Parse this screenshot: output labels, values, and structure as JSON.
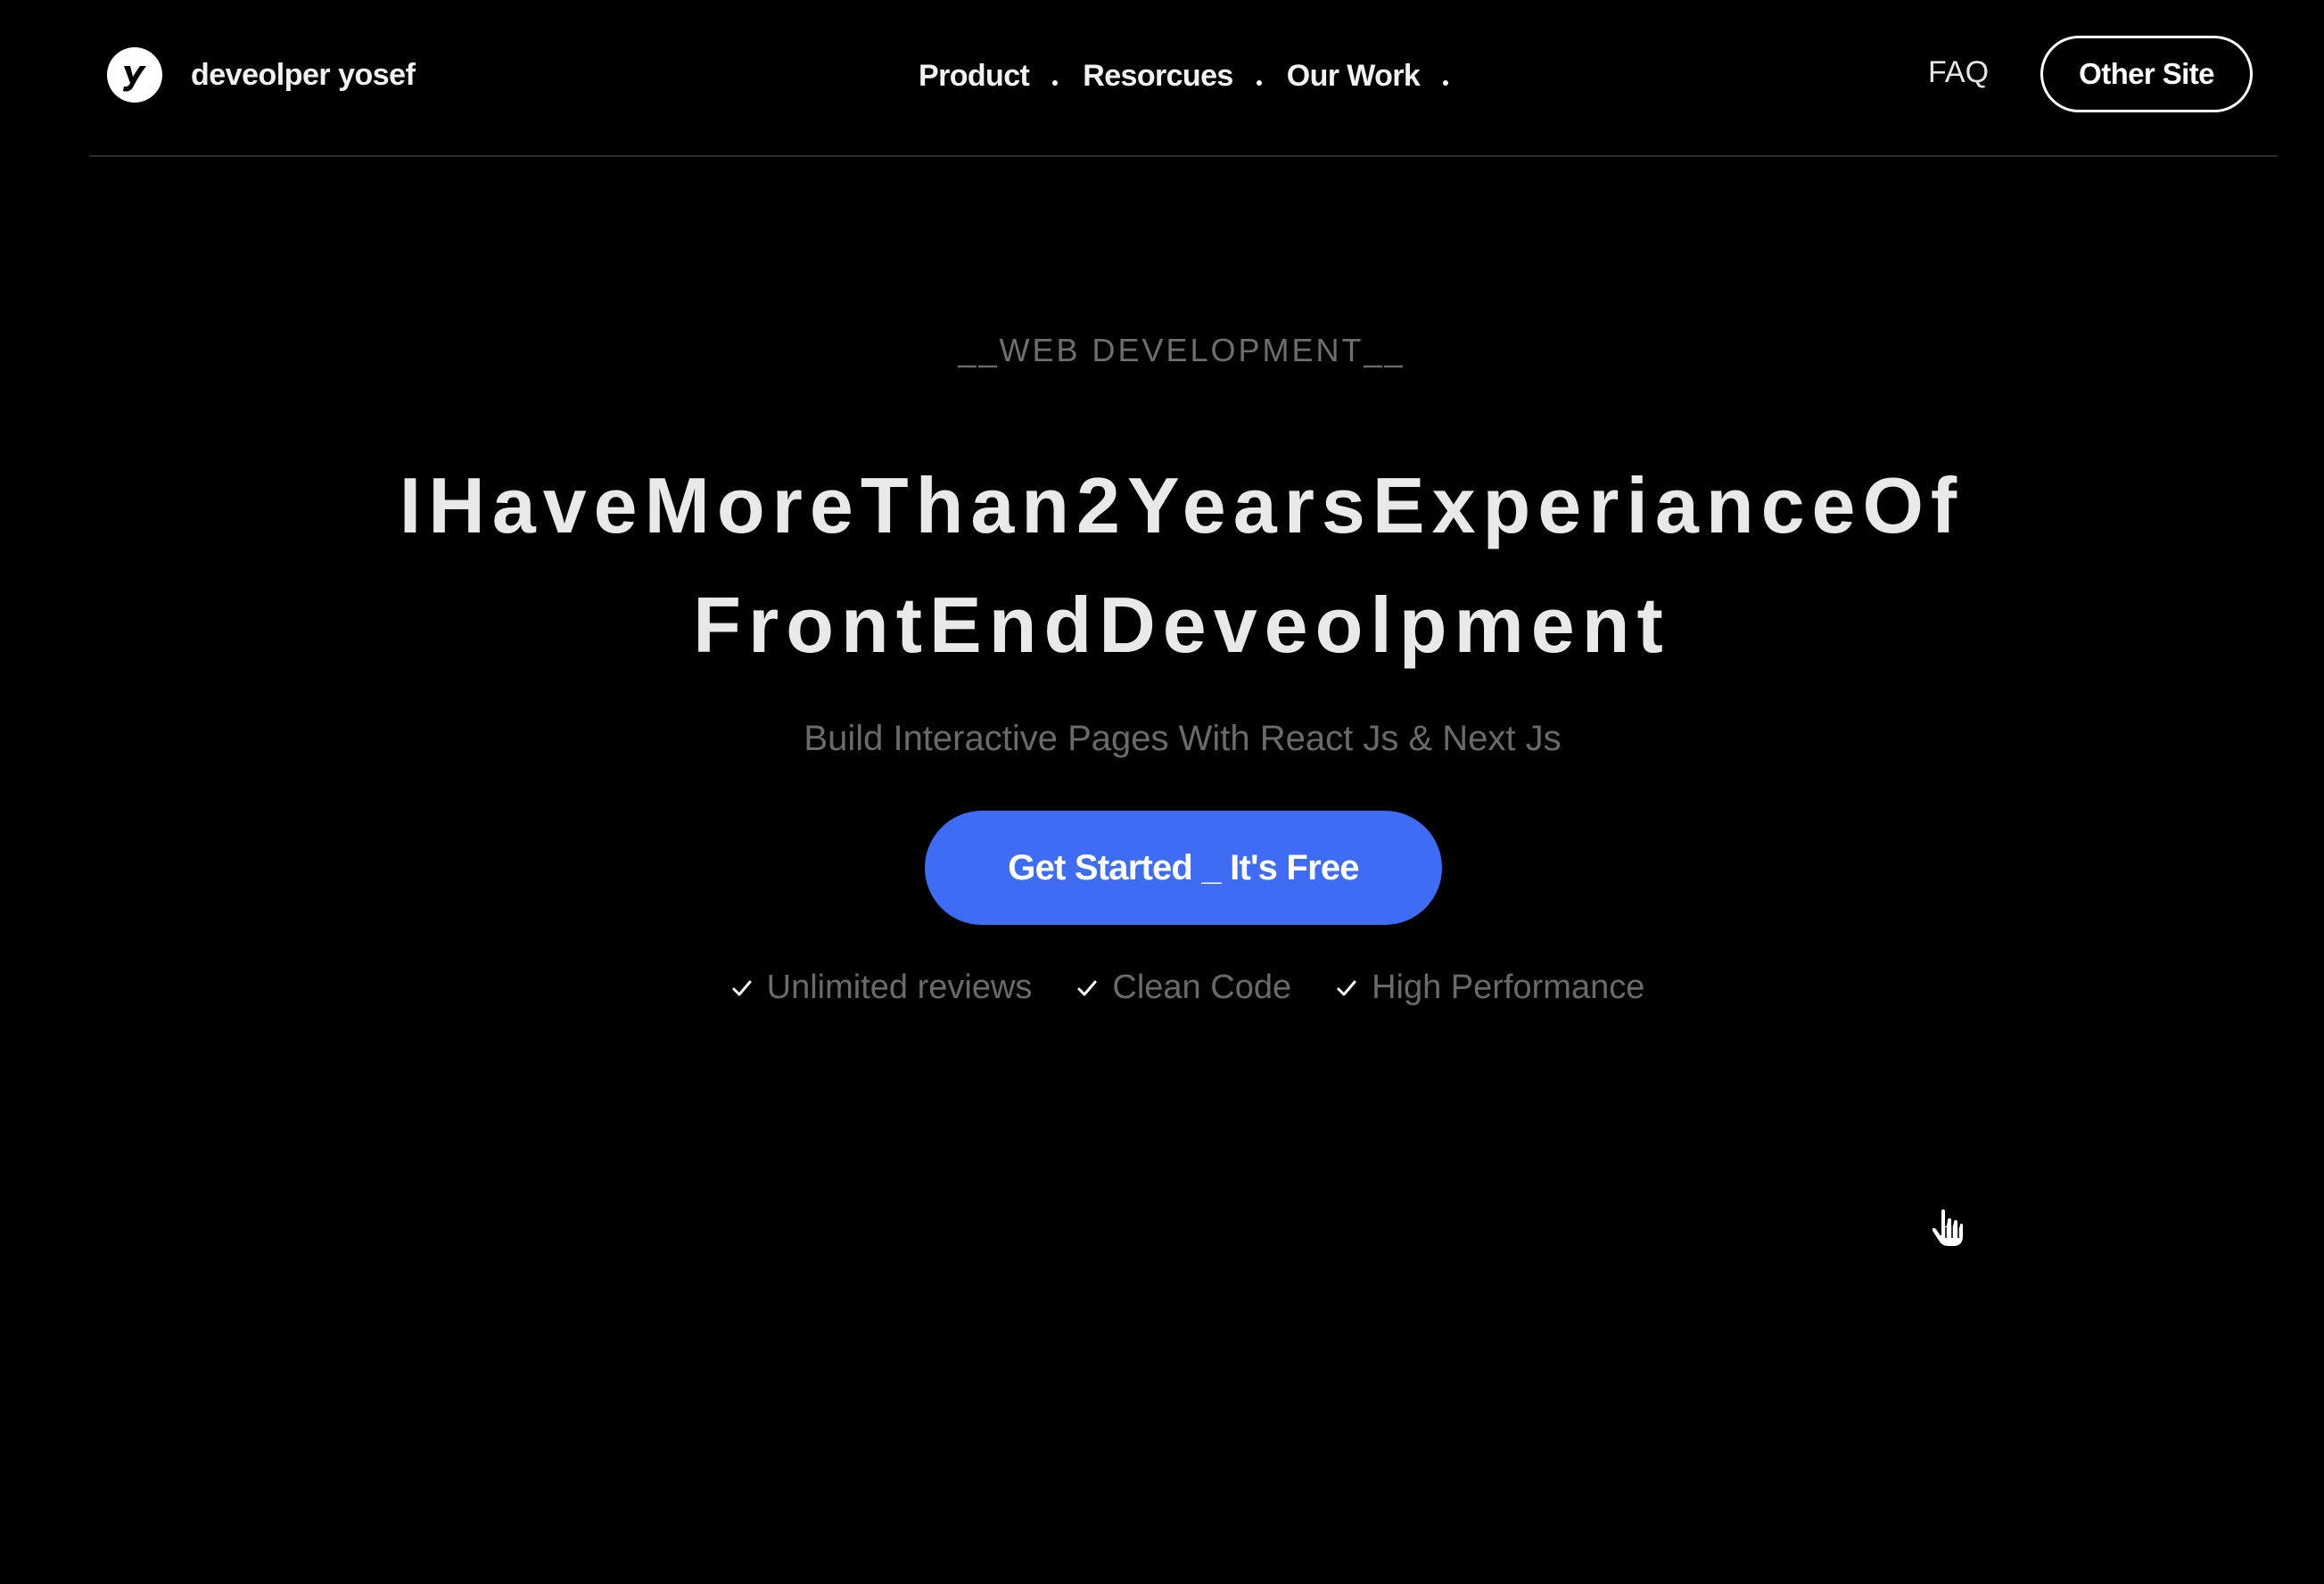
{
  "brand": {
    "logo_icon": "y-logo-icon",
    "name": "deveolper yosef"
  },
  "nav": {
    "items": [
      {
        "label": "Product"
      },
      {
        "label": "Resorcues"
      },
      {
        "label": "Our Work"
      }
    ],
    "faq_label": "FAQ",
    "other_site_label": "Other Site"
  },
  "hero": {
    "eyebrow": "__WEB DEVELOPMENT__",
    "headline_line1": "IHaveMoreThan2YearsExperianceOf",
    "headline_line2": "FrontEndDeveolpment",
    "subtitle": "Build Interactive Pages With React Js & Next Js",
    "cta_label": "Get Started _ It's Free",
    "features": [
      {
        "icon": "check-icon",
        "label": "Unlimited reviews"
      },
      {
        "icon": "check-icon",
        "label": "Clean Code"
      },
      {
        "icon": "check-icon",
        "label": "High Performance"
      }
    ]
  },
  "colors": {
    "background": "#000000",
    "accent": "#3f6cf5",
    "text_primary": "#e9e9e9",
    "text_muted": "#6a6a6a"
  }
}
